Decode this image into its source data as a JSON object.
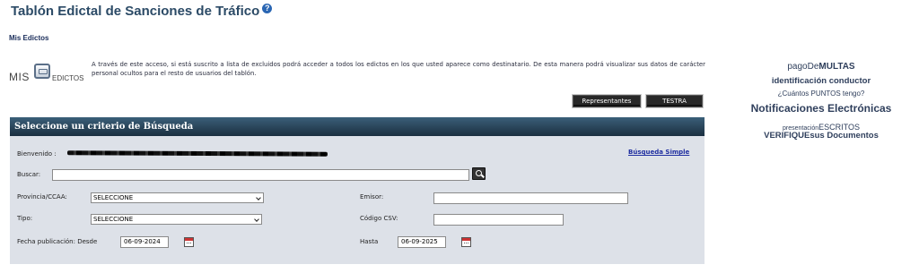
{
  "header": {
    "title": "Tablón Edictal de Sanciones de Tráfico",
    "help_icon_glyph": "?",
    "section": "Mis Edictos"
  },
  "logo": {
    "mis": "MIS",
    "edictos": "EDICTOS"
  },
  "intro": "A través de este acceso, si está suscrito a lista de excluidos podrá acceder a todos los edictos en los que usted aparece como destinatario. De esta manera podrá visualizar sus datos de carácter personal ocultos para el resto de usuarios del tablón.",
  "buttons": {
    "representantes": "Representantes",
    "testra": "TESTRA"
  },
  "search": {
    "header": "Seleccione un criterio de Búsqueda",
    "welcome_label": "Bienvenido :",
    "simple_search_link": "Búsqueda Simple",
    "buscar_label": "Buscar:",
    "buscar_value": "",
    "provincia_label": "Provincia/CCAA:",
    "provincia_selected": "SELECCIONE",
    "tipo_label": "Tipo:",
    "tipo_selected": "SELECCIONE",
    "emisor_label": "Emisor:",
    "emisor_value": "",
    "csv_label": "Código CSV:",
    "csv_value": "",
    "fecha_label": "Fecha publicación: Desde",
    "desde_value": "06-09-2024",
    "hasta_label": "Hasta",
    "hasta_value": "06-09-2025"
  },
  "side_links": {
    "multas_pre": "pago",
    "multas_mid": "De",
    "multas_bold": "MULTAS",
    "identificacion": "identificación conductor",
    "puntos": "¿Cuántos PUNTOS tengo?",
    "notificaciones": "Notificaciones Electrónicas",
    "escritos_pre": "presentación",
    "escritos_bold": "ESCRITOS",
    "verifique_bold": "VERIFIQUE",
    "verifique_post": "sus Documentos"
  },
  "colors": {
    "title": "#2b4a66",
    "panel_header": "#1b2f40",
    "panel_bg": "#dde1e8",
    "link": "#1f2ea0",
    "side_links": "#2f3f5c"
  },
  "icons": {
    "help": "help-circle-icon",
    "search": "magnifier-icon",
    "calendar": "calendar-icon"
  }
}
